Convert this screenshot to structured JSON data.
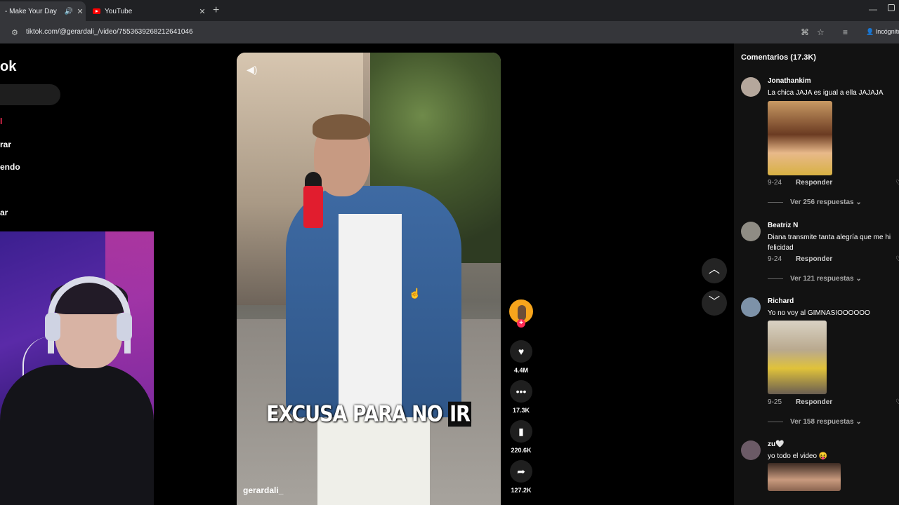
{
  "browser": {
    "tabs": [
      {
        "title": "- Make Your Day",
        "active": true
      },
      {
        "title": "YouTube",
        "active": false
      }
    ],
    "url": "tiktok.com/@gerardali_/video/7553639268212641046",
    "incognito_label": "Incógnito"
  },
  "sidebar": {
    "logo": "ok",
    "items": [
      {
        "label": "l",
        "active": true
      },
      {
        "label": "rar",
        "active": false
      },
      {
        "label": "endo",
        "active": false
      },
      {
        "label": "ar",
        "active": false
      }
    ]
  },
  "video": {
    "caption_main": "EXCUSA PARA NO",
    "caption_highlight": "IR",
    "author": "gerardali_"
  },
  "actions": {
    "likes": "4.4M",
    "comments": "17.3K",
    "saves": "220.6K",
    "shares": "127.2K"
  },
  "comments": {
    "header": "Comentarios (17.3K)",
    "items": [
      {
        "user": "Jonathankim",
        "text": "La chica JAJA es igual a ella JAJAJA",
        "date": "9-24",
        "reply": "Responder",
        "more": "Ver 256 respuestas"
      },
      {
        "user": "Beatriz N",
        "text": "Diana transmite tanta alegría que me hi felicidad",
        "date": "9-24",
        "reply": "Responder",
        "more": "Ver 121 respuestas"
      },
      {
        "user": "Richard",
        "text": "Yo no voy al GIMNASIOOOOOO",
        "date": "9-25",
        "reply": "Responder",
        "more": "Ver 158 respuestas"
      },
      {
        "user": "zu🤍",
        "text": "yo todo el video 😝"
      }
    ]
  },
  "colors": {
    "accent": "#fe2c55",
    "avatar_ring": "#f7a51c"
  }
}
